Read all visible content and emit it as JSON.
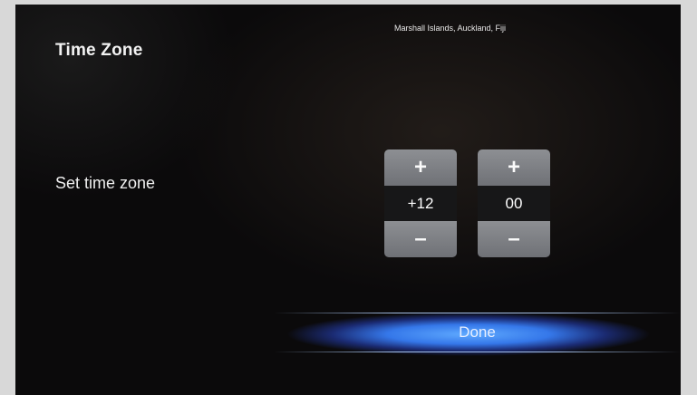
{
  "header": {
    "title": "Time Zone",
    "zone_name": "Marshall Islands, Auckland, Fiji"
  },
  "settings": {
    "label": "Set time zone",
    "hours": {
      "plus_label": "+",
      "value": "+12",
      "minus_label": "–"
    },
    "minutes": {
      "plus_label": "+",
      "value": "00",
      "minus_label": "–"
    }
  },
  "footer": {
    "done_label": "Done"
  },
  "colors": {
    "background": "#0b0a0b",
    "spinner_button": "#7d7f84",
    "done_glow": "#4a8cff"
  }
}
